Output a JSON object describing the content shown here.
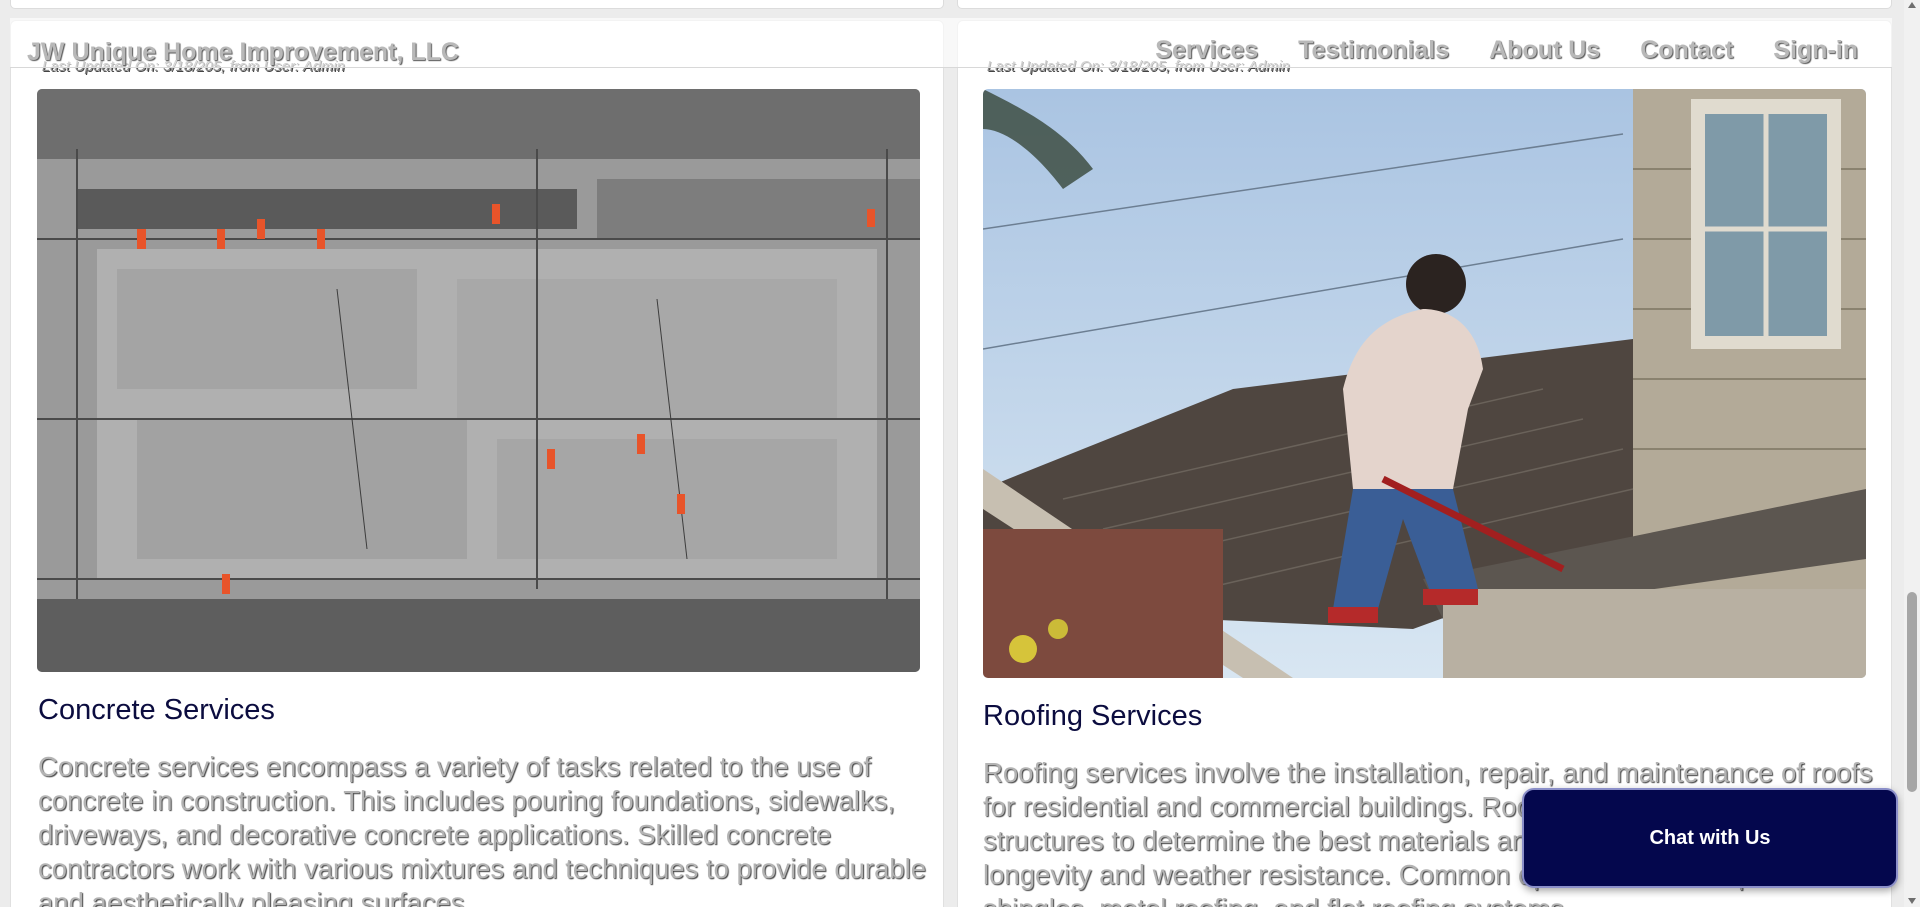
{
  "brand": "JW Unique Home Improvement, LLC",
  "nav": {
    "services": "Services",
    "testimonials": "Testimonials",
    "about": "About Us",
    "contact": "Contact",
    "signin": "Sign-in"
  },
  "cards": {
    "concrete": {
      "updated": "Last Updated On: 3/18/205, from User: Admin",
      "title": "Concrete Services",
      "text": "Concrete services encompass a variety of tasks related to the use of concrete in construction. This includes pouring foundations, sidewalks, driveways, and decorative concrete applications. Skilled concrete contractors work with various mixtures and techniques to provide durable and aesthetically pleasing surfaces."
    },
    "roofing": {
      "updated": "Last Updated On: 3/18/205, from User: Admin",
      "title": "Roofing Services",
      "text": "Roofing services involve the installation, repair, and maintenance of roofs for residential and commercial buildings. Roofers assess existing structures to determine the best materials and methods suitable for longevity and weather resistance. Common options include asphalt shingles, metal roofing, and flat roofing systems."
    }
  },
  "chat": {
    "label": "Chat with Us"
  },
  "colors": {
    "title": "#0b0c3f",
    "chat_bg": "#04074d",
    "chat_border": "#8b8fc9"
  }
}
